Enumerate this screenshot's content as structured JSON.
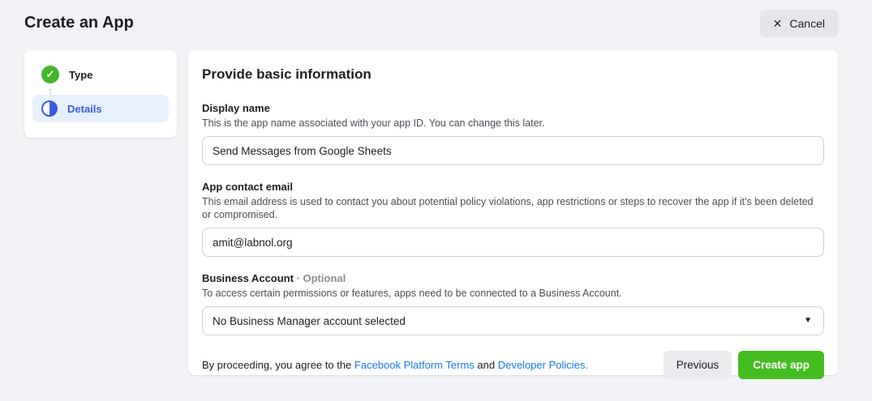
{
  "header": {
    "title": "Create an App",
    "cancel_label": "Cancel"
  },
  "icons": {
    "close": "✕",
    "check": "✓",
    "caret_down": "▼"
  },
  "steps": [
    {
      "label": "Type",
      "state": "complete"
    },
    {
      "label": "Details",
      "state": "active"
    }
  ],
  "main": {
    "heading": "Provide basic information",
    "fields": {
      "display_name": {
        "label": "Display name",
        "description": "This is the app name associated with your app ID. You can change this later.",
        "value": "Send Messages from Google Sheets"
      },
      "contact_email": {
        "label": "App contact email",
        "description": "This email address is used to contact you about potential policy violations, app restrictions or steps to recover the app if it's been deleted or compromised.",
        "value": "amit@labnol.org"
      },
      "business_account": {
        "label": "Business Account",
        "optional_label": "· Optional",
        "description": "To access certain permissions or features, apps need to be connected to a Business Account.",
        "selected_option": "No Business Manager account selected"
      }
    },
    "footer": {
      "agreement_prefix": "By proceeding, you agree to the ",
      "terms_link": "Facebook Platform Terms",
      "and_text": " and ",
      "policies_link": "Developer Policies.",
      "previous_label": "Previous",
      "create_label": "Create app"
    }
  },
  "colors": {
    "background": "#f0f2f5",
    "accent_blue": "#3b5be0",
    "link_blue": "#1877f2",
    "success_green": "#42b72a",
    "button_green": "#45bd20"
  }
}
